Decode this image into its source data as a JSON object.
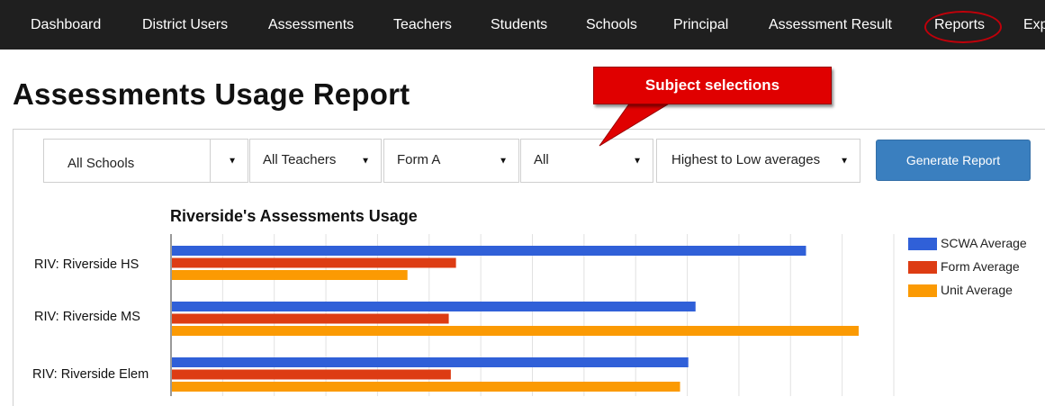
{
  "nav": {
    "items": [
      {
        "label": "Dashboard",
        "x": 34
      },
      {
        "label": "District Users",
        "x": 158
      },
      {
        "label": "Assessments",
        "x": 298
      },
      {
        "label": "Teachers",
        "x": 437
      },
      {
        "label": "Students",
        "x": 545
      },
      {
        "label": "Schools",
        "x": 651
      },
      {
        "label": "Principal",
        "x": 748
      },
      {
        "label": "Assessment Result",
        "x": 854
      },
      {
        "label": "Reports",
        "x": 1038
      },
      {
        "label": "Exp",
        "x": 1137
      }
    ]
  },
  "page": {
    "title": "Assessments Usage Report"
  },
  "callout": {
    "text": "Subject selections"
  },
  "filters": {
    "school": "All Schools",
    "teacher": "All Teachers",
    "form": "Form A",
    "subject": "All",
    "sort": "Highest to Low averages",
    "generate_label": "Generate Report"
  },
  "chart_data": {
    "type": "bar",
    "orientation": "horizontal",
    "title": "Riverside's Assessments Usage",
    "categories": [
      "RIV: Riverside HS",
      "RIV: Riverside MS",
      "RIV: Riverside Elem"
    ],
    "series": [
      {
        "name": "SCWA Average",
        "color": "#3060d8",
        "values": [
          61.5,
          50.8,
          50.1
        ]
      },
      {
        "name": "Form Average",
        "color": "#dd3c13",
        "values": [
          27.6,
          26.9,
          27.1
        ]
      },
      {
        "name": "Unit Average",
        "color": "#fb9a03",
        "values": [
          22.9,
          66.6,
          49.3
        ]
      }
    ],
    "xlim": [
      0,
      70
    ],
    "grid": true,
    "legend_position": "right"
  }
}
